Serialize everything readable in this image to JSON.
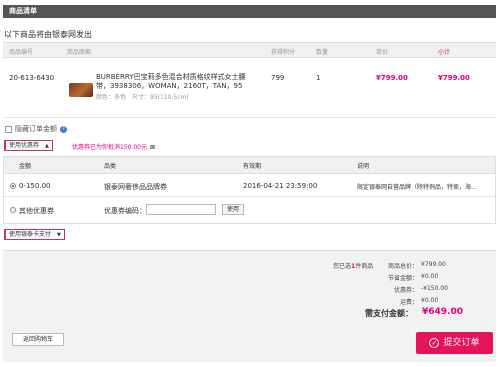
{
  "header": {
    "title": "商品清单"
  },
  "subtitle": "以下商品将由银泰网发出",
  "table": {
    "columns": [
      "商品编号",
      "商品图橱",
      "获得积分",
      "数量",
      "单价",
      "小计"
    ],
    "row": {
      "sku": "20-613-6430",
      "name": "BURBERRY巴宝莉多色混合材质格纹样式女士腰带，3938306，WOMAN，2160T，TAN，95",
      "attrs": "颜色：多色　尺寸：95(110.5cm)",
      "points": "799",
      "qty": "1",
      "unit_price": "¥799.00",
      "subtotal": "¥799.00"
    }
  },
  "hide_amount": {
    "label": "隐藏订单金额"
  },
  "coupon": {
    "toggle_label": "使用优惠券",
    "note": "优惠券已为你抵消150.00元",
    "close": "⊠",
    "headers": [
      "金额",
      "品类",
      "有效期",
      "说明"
    ],
    "row1": {
      "amount": "0-150.00",
      "category": "银泰网奢侈品品牌券",
      "valid": "2016-04-21 23:59:00",
      "desc": "限定银泰网自营品牌（除特例品，特卖，海..."
    },
    "row2": {
      "label": "其他优惠券",
      "code_label": "优惠券编码：",
      "use_button": "使用"
    }
  },
  "giftcard": {
    "toggle_label": "使用银泰卡支付"
  },
  "summary": {
    "selected_prefix": "您已选",
    "selected_count": "1",
    "selected_suffix": "件商品",
    "total_label": "商品总价：",
    "total_value": "¥799.00",
    "saved_label": "节省金额：",
    "saved_value": "¥0.00",
    "coupon_label": "优惠券：",
    "coupon_value": "-¥150.00",
    "shipping_label": "运费：",
    "shipping_value": "¥0.00",
    "due_label": "需支付金额：",
    "due_value": "¥649.00"
  },
  "actions": {
    "back": "返回购物车",
    "submit": "提交订单"
  },
  "colors": {
    "accent": "#e4007f",
    "submit": "#e4145b",
    "header": "#555555"
  }
}
